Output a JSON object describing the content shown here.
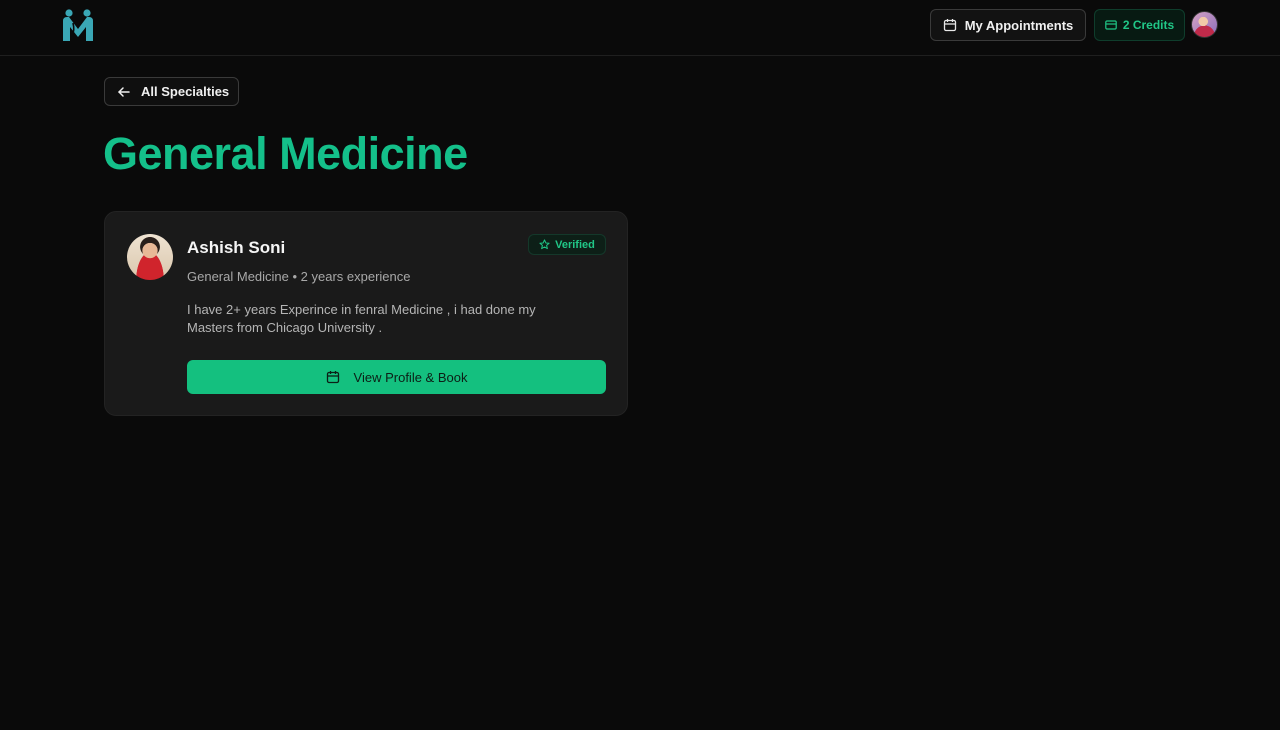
{
  "header": {
    "logo_icon": "medical-m-logo",
    "appointments_label": "My Appointments",
    "appointments_icon": "calendar-icon",
    "credits_label": "2 Credits",
    "credits_icon": "credit-card-icon",
    "avatar_icon": "user-avatar"
  },
  "nav": {
    "back_label": "All Specialties",
    "back_icon": "arrow-left-icon"
  },
  "page": {
    "title": "General Medicine"
  },
  "doctor_card": {
    "name": "Ashish Soni",
    "verified_label": "Verified",
    "verified_icon": "star-icon",
    "meta": "General Medicine • 2 years experience",
    "bio_line1": "I have 2+ years Experince in fenral Medicine , i had done my",
    "bio_line2": "Masters from Chicago University .",
    "book_label": "View Profile & Book",
    "book_icon": "calendar-icon"
  },
  "colors": {
    "accent": "#14c08a",
    "background": "#0a0a0a",
    "card": "#1a1a1a",
    "logo": "#3aa7b5"
  }
}
